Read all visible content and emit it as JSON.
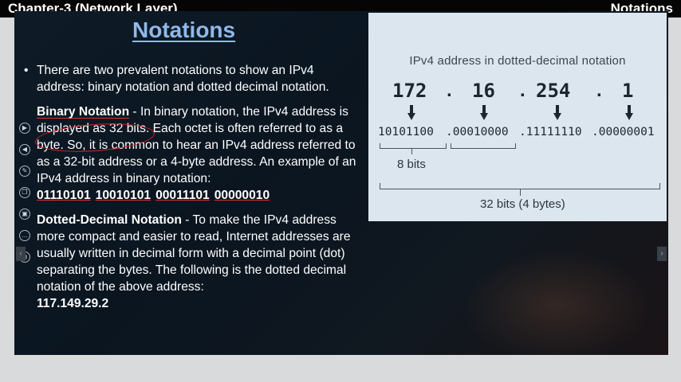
{
  "header": {
    "chapter_label": "Chapter-3 (Network Layer)",
    "corner_label": "Notations"
  },
  "slide": {
    "title": "Notations",
    "intro": "There are two prevalent notations to show an IPv4 address: binary notation and dotted decimal notation.",
    "binary": {
      "term": "Binary Notation",
      "text": " - In binary notation, the IPv4 address is displayed as 32 bits. Each octet is often referred to as a byte. So, it is common to hear an IPv4 address referred to as a 32-bit address or a 4-byte address. An example of an IPv4 address in binary notation:",
      "example": [
        "01110101",
        "10010101",
        "00011101",
        "00000010"
      ]
    },
    "dotted": {
      "term": "Dotted-Decimal Notation",
      "text": " - To make the IPv4 address more compact and easier to read, Internet addresses are usually written in decimal form with a decimal point (dot) separating the bytes. The following is the dotted decimal notation of the above address:",
      "example": "117.149.29.2"
    }
  },
  "diagram": {
    "title": "IPv4 address in dotted-decimal notation",
    "octets": [
      "172",
      "16",
      "254",
      "1"
    ],
    "dot": ".",
    "binary": [
      "10101100",
      ".00010000",
      ".11111110",
      ".00000001"
    ],
    "label_byte": "8 bits",
    "label_total": "32 bits (4 bytes)"
  },
  "colors": {
    "title": "#8fb9e8",
    "annotation": "#d2262a",
    "diagram_bg": "#dce6ef"
  },
  "icons": [
    "play-icon",
    "back-icon",
    "pen-icon",
    "copy-icon",
    "image-icon",
    "more-icon",
    "globe-icon"
  ]
}
